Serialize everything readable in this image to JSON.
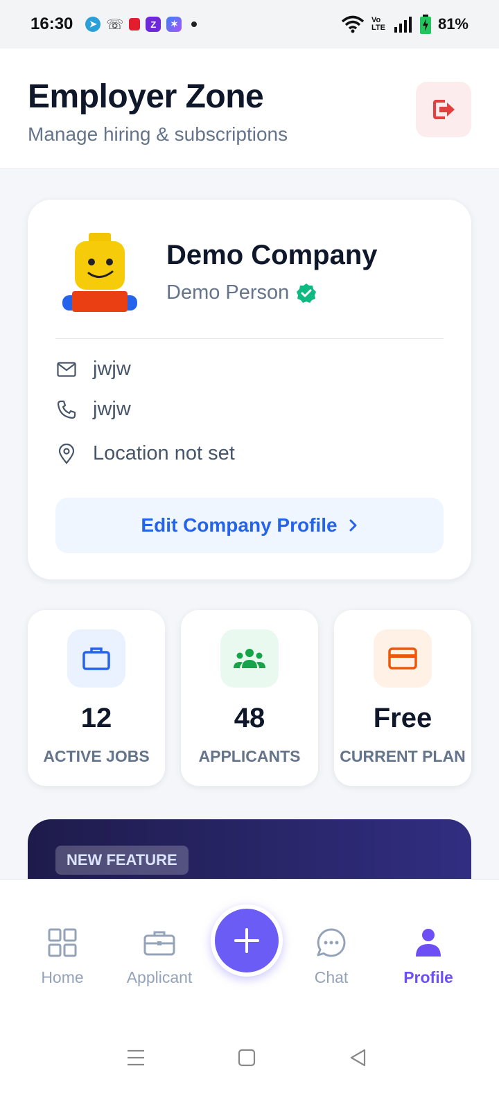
{
  "status_bar": {
    "time": "16:30",
    "notification_icons": [
      "telegram-icon",
      "missed-call-icon",
      "shopping-bag-icon",
      "zepto-icon",
      "app-icon",
      "dot-icon"
    ],
    "volte": "Vo LTE",
    "battery": "81%"
  },
  "header": {
    "title": "Employer Zone",
    "subtitle": "Manage hiring & subscriptions",
    "logout_icon": "logout-icon"
  },
  "profile": {
    "company_name": "Demo Company",
    "person_name": "Demo Person",
    "verified": true,
    "email": "jwjw",
    "phone": "jwjw",
    "location": "Location not set",
    "edit_button": "Edit Company Profile"
  },
  "stats": [
    {
      "value": "12",
      "label": "ACTIVE JOBS",
      "icon": "briefcase-icon",
      "color": "#2563eb",
      "bg": "#eaf2ff"
    },
    {
      "value": "48",
      "label": "APPLICANTS",
      "icon": "users-icon",
      "color": "#16a34a",
      "bg": "#e9f9ef"
    },
    {
      "value": "Free",
      "label": "CURRENT PLAN",
      "icon": "credit-card-icon",
      "color": "#ea580c",
      "bg": "#fff1e6"
    }
  ],
  "promo": {
    "badge": "NEW FEATURE"
  },
  "bottom_nav": {
    "items": [
      {
        "label": "Home",
        "icon": "grid-icon",
        "active": false
      },
      {
        "label": "Applicant",
        "icon": "briefcase-icon",
        "active": false
      },
      {
        "label": "Chat",
        "icon": "chat-icon",
        "active": false
      },
      {
        "label": "Profile",
        "icon": "user-icon",
        "active": true
      }
    ],
    "fab_icon": "plus-icon"
  },
  "colors": {
    "accent": "#6b5cf6",
    "link": "#2563eb",
    "logout": "#e53e3e",
    "verified": "#10b981"
  }
}
